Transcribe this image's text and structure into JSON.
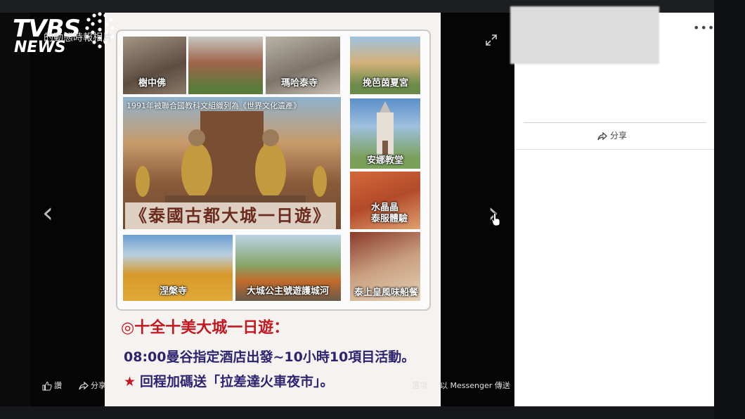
{
  "logo": {
    "brand": "TVBS",
    "sub": "NEWS"
  },
  "viewer": {
    "album_label": "的動態時報相片"
  },
  "poster": {
    "tiles": [
      {
        "label": "樹中佛"
      },
      {
        "label": ""
      },
      {
        "label": "瑪哈泰寺"
      },
      {
        "label": "挽芭茵夏宮"
      },
      {
        "label": "安娜教堂"
      },
      {
        "label": "水晶晶\n泰服體驗"
      },
      {
        "label": "涅槃寺"
      },
      {
        "label": "大城公主號遊護城河"
      },
      {
        "label": "泰上皇風味船餐"
      }
    ],
    "banner_caption": "1991年被聯合國教科文組織列為《世界文化遺產》",
    "banner_title": "《泰國古都大城一日遊》",
    "headline": "◎十全十美大城一日遊：",
    "line1": "08:00曼谷指定酒店出發~10小時10項目活動。",
    "line2_star": "★",
    "line2": "回程加碼送「拉差達火車夜市」。"
  },
  "actions": {
    "like": "讚",
    "share": "分享",
    "options": "選項",
    "messenger": "以 Messenger 傳送"
  },
  "side": {
    "share": "分享",
    "more": "•••"
  }
}
